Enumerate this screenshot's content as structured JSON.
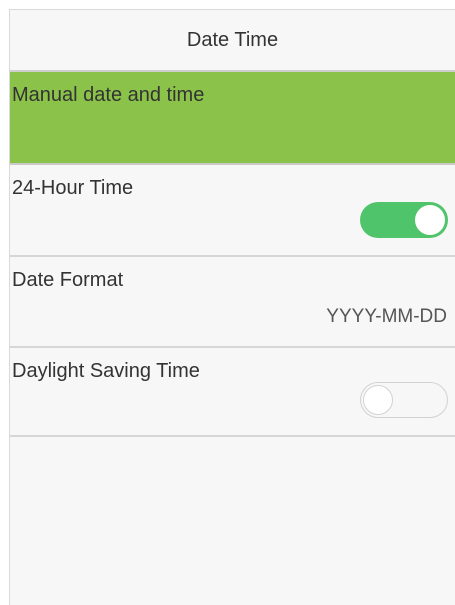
{
  "header": {
    "title": "Date Time"
  },
  "settings": {
    "manual": {
      "label": "Manual date and time"
    },
    "hour24": {
      "label": "24-Hour Time",
      "enabled": true,
      "on_color": "#4fc46a"
    },
    "date_format": {
      "label": "Date Format",
      "value": "YYYY-MM-DD"
    },
    "dst": {
      "label": "Daylight Saving Time",
      "enabled": false
    }
  },
  "colors": {
    "highlight": "#8bc34a",
    "toggle_on": "#4fc46a",
    "background": "#f7f7f7",
    "divider": "#d6d6d6"
  }
}
